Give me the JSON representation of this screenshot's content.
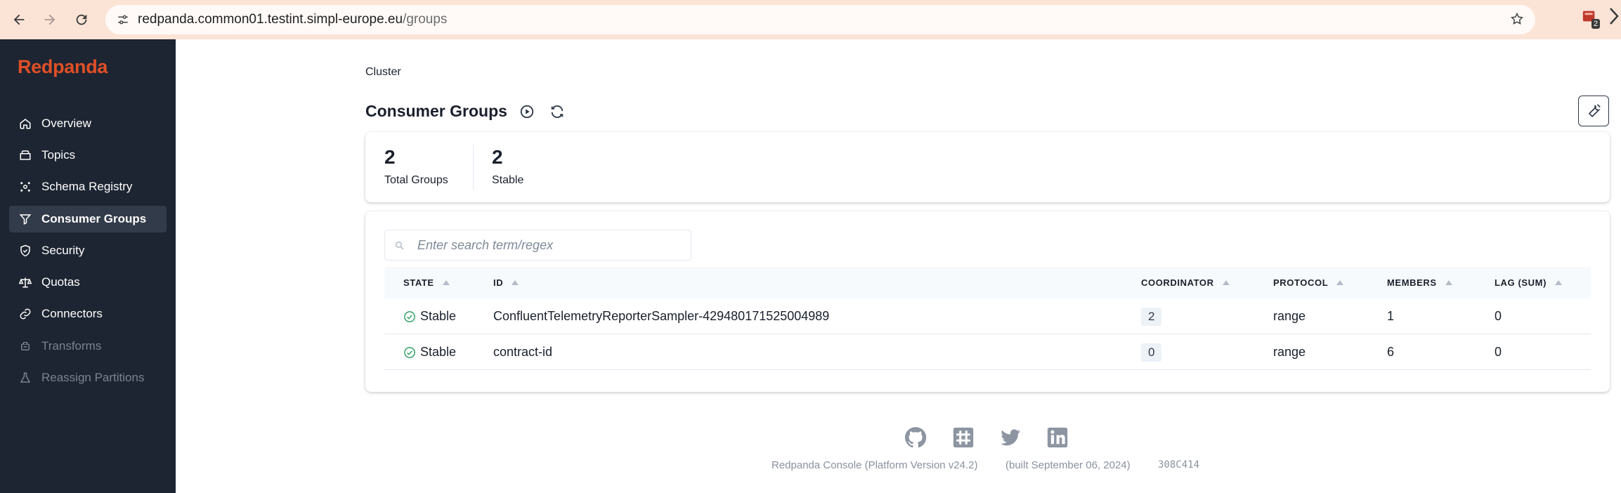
{
  "browser": {
    "url_host": "redpanda.common01.testint.simpl-europe.eu",
    "url_path": "/groups",
    "extension_badge": "2"
  },
  "sidebar": {
    "brand": "Redpanda",
    "items": [
      {
        "label": "Overview",
        "icon": "home-icon"
      },
      {
        "label": "Topics",
        "icon": "topics-icon"
      },
      {
        "label": "Schema Registry",
        "icon": "schema-icon"
      },
      {
        "label": "Consumer Groups",
        "icon": "funnel-icon"
      },
      {
        "label": "Security",
        "icon": "shield-icon"
      },
      {
        "label": "Quotas",
        "icon": "scale-icon"
      },
      {
        "label": "Connectors",
        "icon": "link-icon"
      },
      {
        "label": "Transforms",
        "icon": "transforms-icon"
      },
      {
        "label": "Reassign Partitions",
        "icon": "flask-icon"
      }
    ],
    "active": "Consumer Groups"
  },
  "breadcrumb": "Cluster",
  "page_title": "Consumer Groups",
  "stats": [
    {
      "value": "2",
      "label": "Total Groups"
    },
    {
      "value": "2",
      "label": "Stable"
    }
  ],
  "search": {
    "placeholder": "Enter search term/regex",
    "value": ""
  },
  "table": {
    "columns": [
      "STATE",
      "ID",
      "COORDINATOR",
      "PROTOCOL",
      "MEMBERS",
      "LAG (SUM)"
    ],
    "rows": [
      {
        "state": "Stable",
        "id": "ConfluentTelemetryReporterSampler-429480171525004989",
        "coordinator": "2",
        "protocol": "range",
        "members": "1",
        "lag": "0"
      },
      {
        "state": "Stable",
        "id": "contract-id",
        "coordinator": "0",
        "protocol": "range",
        "members": "6",
        "lag": "0"
      }
    ]
  },
  "footer": {
    "version": "Redpanda Console (Platform Version v24.2)",
    "built": "(built September 06, 2024)",
    "commit": "308C414",
    "icons": [
      "github-icon",
      "slack-icon",
      "twitter-icon",
      "linkedin-icon"
    ]
  },
  "colors": {
    "brand": "#e14f26",
    "sidebar_bg": "#1d2532",
    "sidebar_active": "#323b4a",
    "browser_bar": "#fbe3d6",
    "stable_green": "#38a169"
  }
}
